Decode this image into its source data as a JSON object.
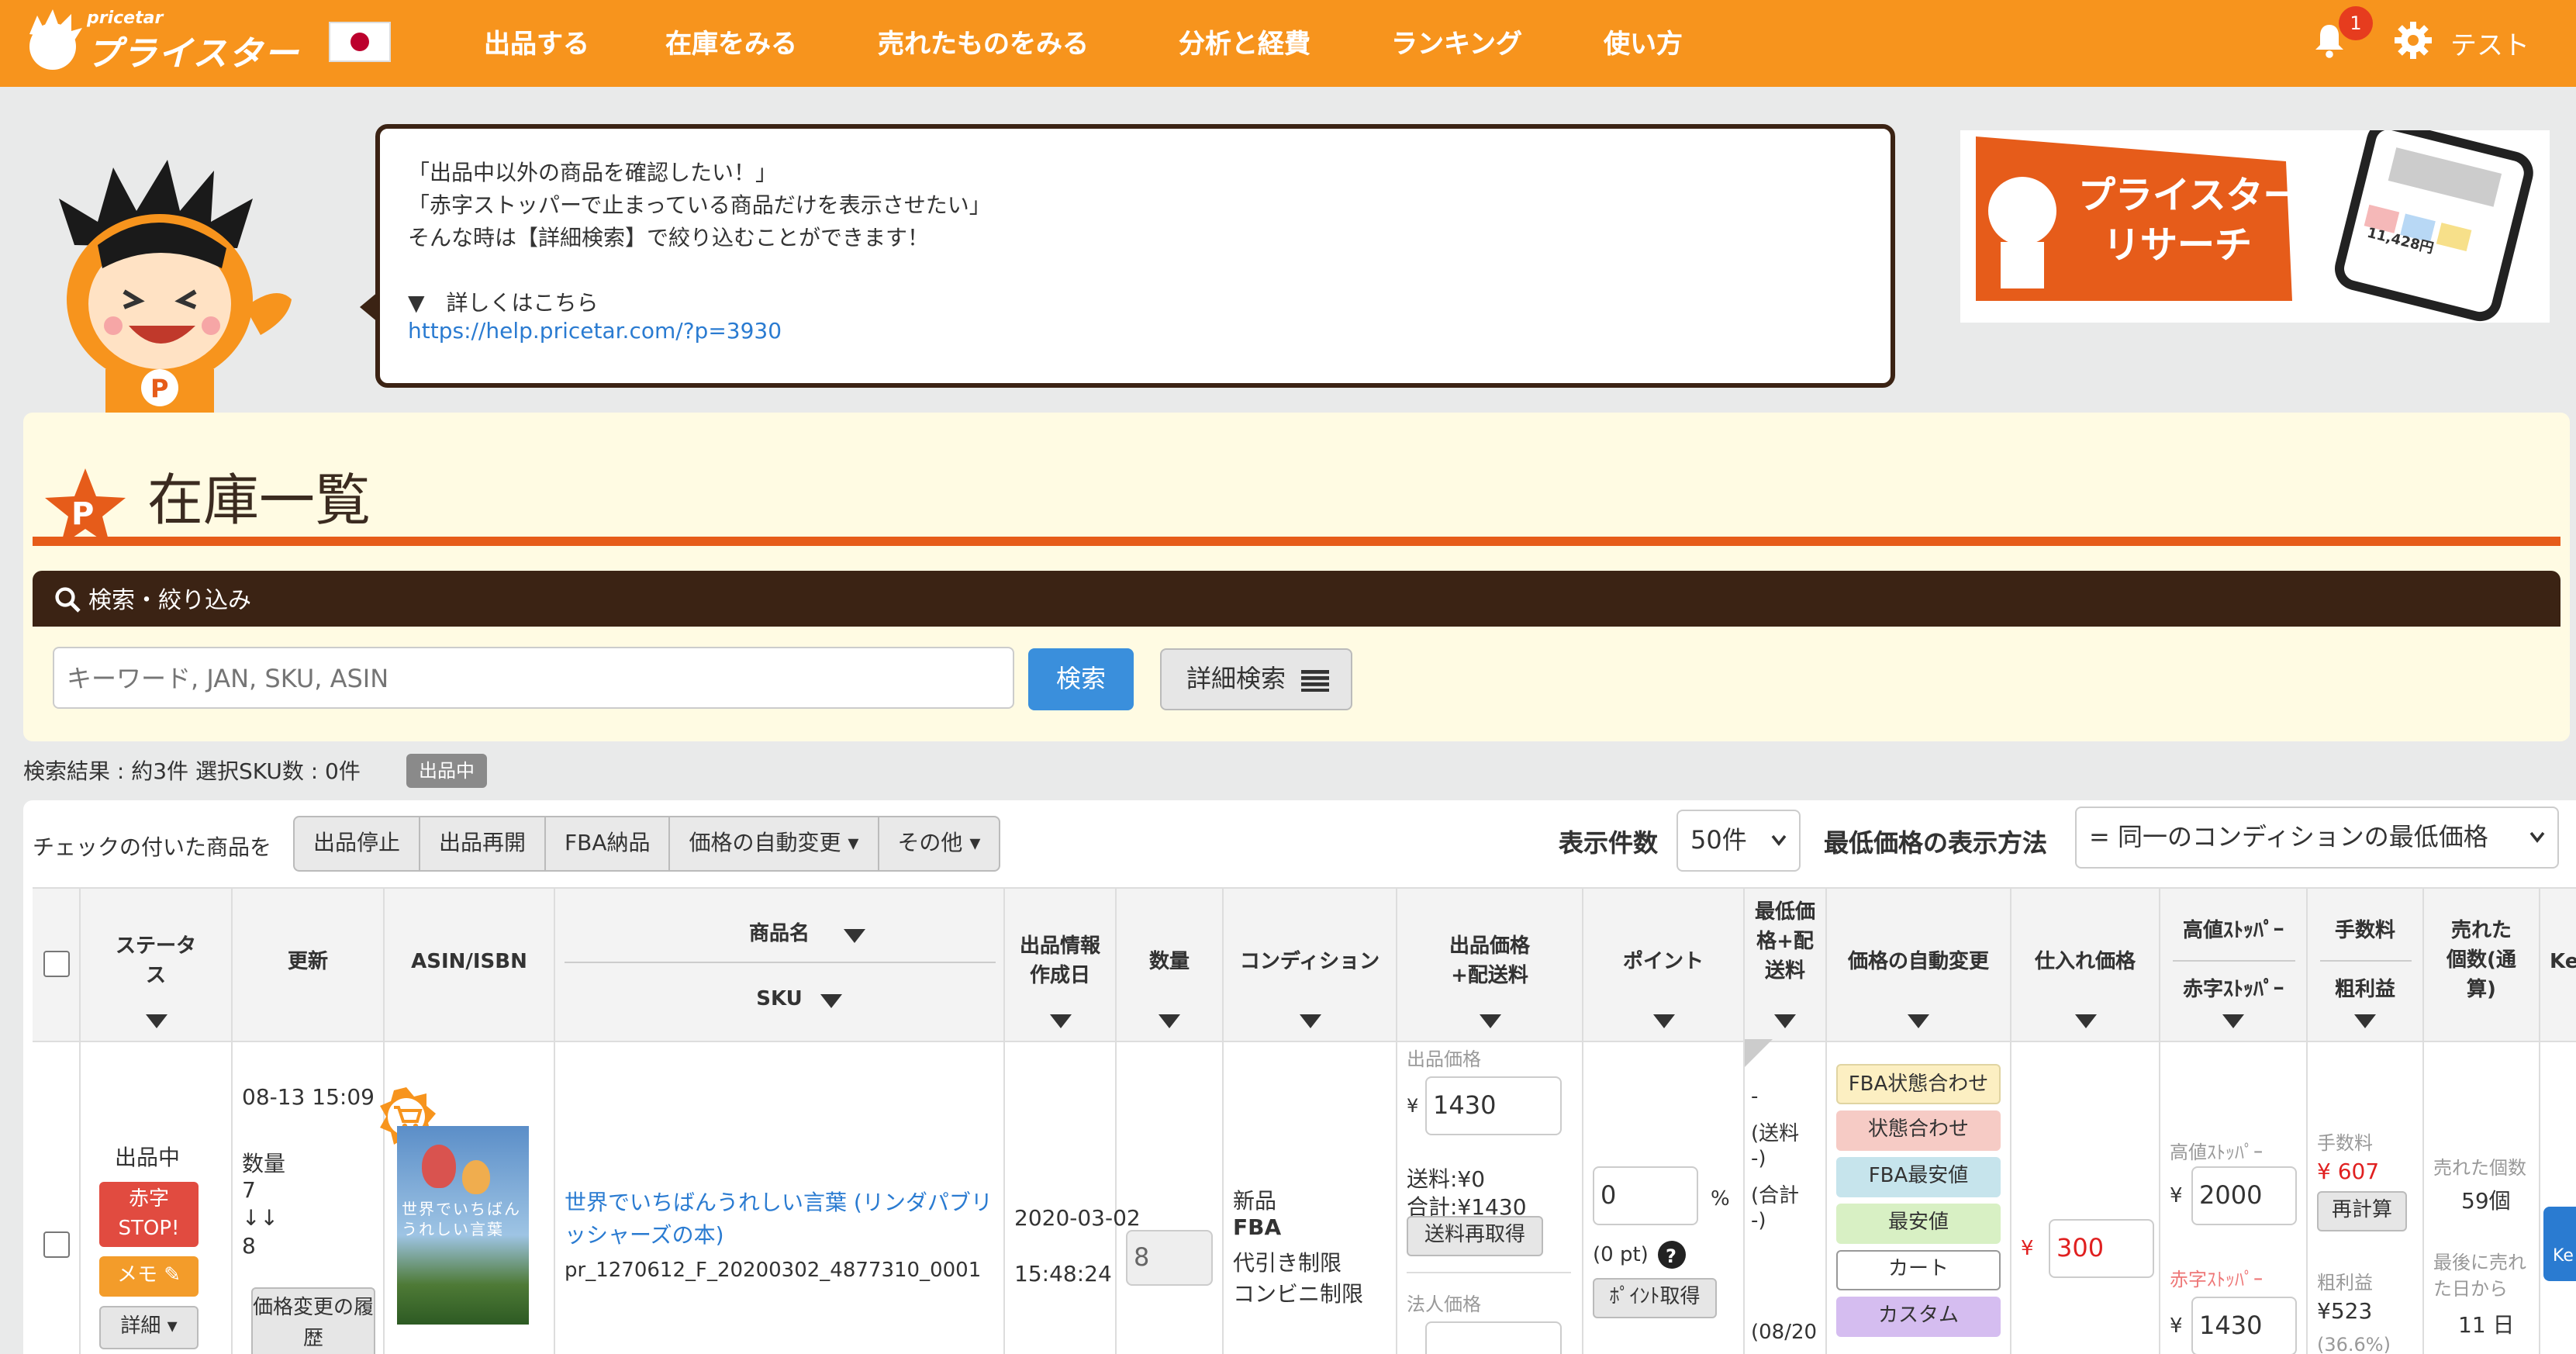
{
  "header": {
    "logo_small": "pricetar",
    "logo_big": "プライスター",
    "nav": [
      "出品する",
      "在庫をみる",
      "売れたものをみる",
      "分析と経費",
      "ランキング",
      "使い方"
    ],
    "notification_count": "1",
    "username": "テスト",
    "colors": {
      "bar": "#f7941d",
      "badge": "#e63c1e"
    }
  },
  "tip": {
    "line1": "「出品中以外の商品を確認したい！」",
    "line2": "「赤字ストッパーで止まっている商品だけを表示させたい」",
    "line3": "そんな時は【詳細検索】で絞り込むことができます！",
    "more": "▼　詳しくはこちら",
    "url": "https://help.pricetar.com/?p=3930"
  },
  "banner": {
    "line1": "プライスター",
    "line2": "リサーチ",
    "stat": "11,428円"
  },
  "page": {
    "title": "在庫一覧",
    "star_letter": "P"
  },
  "search": {
    "section_label": "検索・絞り込み",
    "placeholder": "キーワード, JAN, SKU, ASIN",
    "search_button": "検索",
    "advanced_button": "詳細検索"
  },
  "results": {
    "summary": "検索結果 : 約3件  選択SKU数 : 0件",
    "status_badge": "出品中"
  },
  "toolbar": {
    "checked_label": "チェックの付いた商品を",
    "actions": [
      "出品停止",
      "出品再開",
      "FBA納品",
      "価格の自動変更 ▾",
      "その他 ▾"
    ],
    "per_page_label": "表示件数",
    "per_page_value": "50件",
    "min_price_label": "最低価格の表示方法",
    "min_price_value": "= 同一のコンディションの最低価格"
  },
  "columns": {
    "status": "ステータス",
    "updated": "更新",
    "asin": "ASIN/ISBN",
    "name": "商品名",
    "sku": "SKU",
    "created": "出品情報作成日",
    "qty": "数量",
    "condition": "コンディション",
    "price": "出品価格+配送料",
    "point": "ポイント",
    "min_price": "最低価格+配送料",
    "auto_price": "価格の自動変更",
    "cost": "仕入れ価格",
    "high_stop": "高値ｽﾄｯﾊﾟｰ",
    "red_stop": "赤字ｽﾄｯﾊﾟｰ",
    "fee": "手数料",
    "profit": "粗利益",
    "sold": "売れた個数(通算)",
    "ke": "Ke"
  },
  "row": {
    "status": "出品中",
    "red_stop_btn": "赤字STOP!",
    "memo_btn": "メモ ✎",
    "detail_btn": "詳細 ▾",
    "updated_time": "08-13 15:09",
    "qty_label": "数量",
    "qty_from": "7",
    "qty_arrow": "↓↓",
    "qty_to": "8",
    "history_btn": "価格変更の履歴",
    "book_title": "世界でいちばんうれしい言葉",
    "product_name": "世界でいちばんうれしい言葉 (リンダパブリッシャーズの本)",
    "sku": "pr_1270612_F_20200302_4877310_0001",
    "created_date": "2020-03-02",
    "created_time": "15:48:24",
    "qty": "8",
    "cond1": "新品",
    "cond2": "FBA",
    "cond3": "代引き制限",
    "cond4": "コンビニ制限",
    "price_label": "出品価格",
    "yen": "¥",
    "price": "1430",
    "shipping": "送料:¥0",
    "total": "合計:¥1430",
    "reship_btn": "送料再取得",
    "corp_price_label": "法人価格",
    "point_value": "0",
    "point_pct": "%",
    "point_pt": "(0 pt)",
    "point_btn": "ﾎﾟｲﾝﾄ取得",
    "min_price_lines": [
      "-",
      "(送料",
      "-)",
      "(合計",
      "-)"
    ],
    "min_price_date": "(08/20",
    "auto_options": [
      "FBA状態合わせ",
      "状態合わせ",
      "FBA最安値",
      "最安値",
      "カート",
      "カスタム"
    ],
    "cost_value": "300",
    "high_stop_label": "高値ｽﾄｯﾊﾟｰ",
    "high_stop_value": "2000",
    "red_stop_label": "赤字ｽﾄｯﾊﾟｰ",
    "red_stop_value": "1430",
    "fee_label": "手数料",
    "fee_value": "¥ 607",
    "recalc_btn": "再計算",
    "profit_label": "粗利益",
    "profit_value": "¥523",
    "profit_pct": "(36.6%)",
    "sold_label": "売れた個数",
    "sold_value": "59個",
    "since_label": "最後に売れた日から",
    "since_value": "11 日",
    "ke_btn": "Ke"
  }
}
